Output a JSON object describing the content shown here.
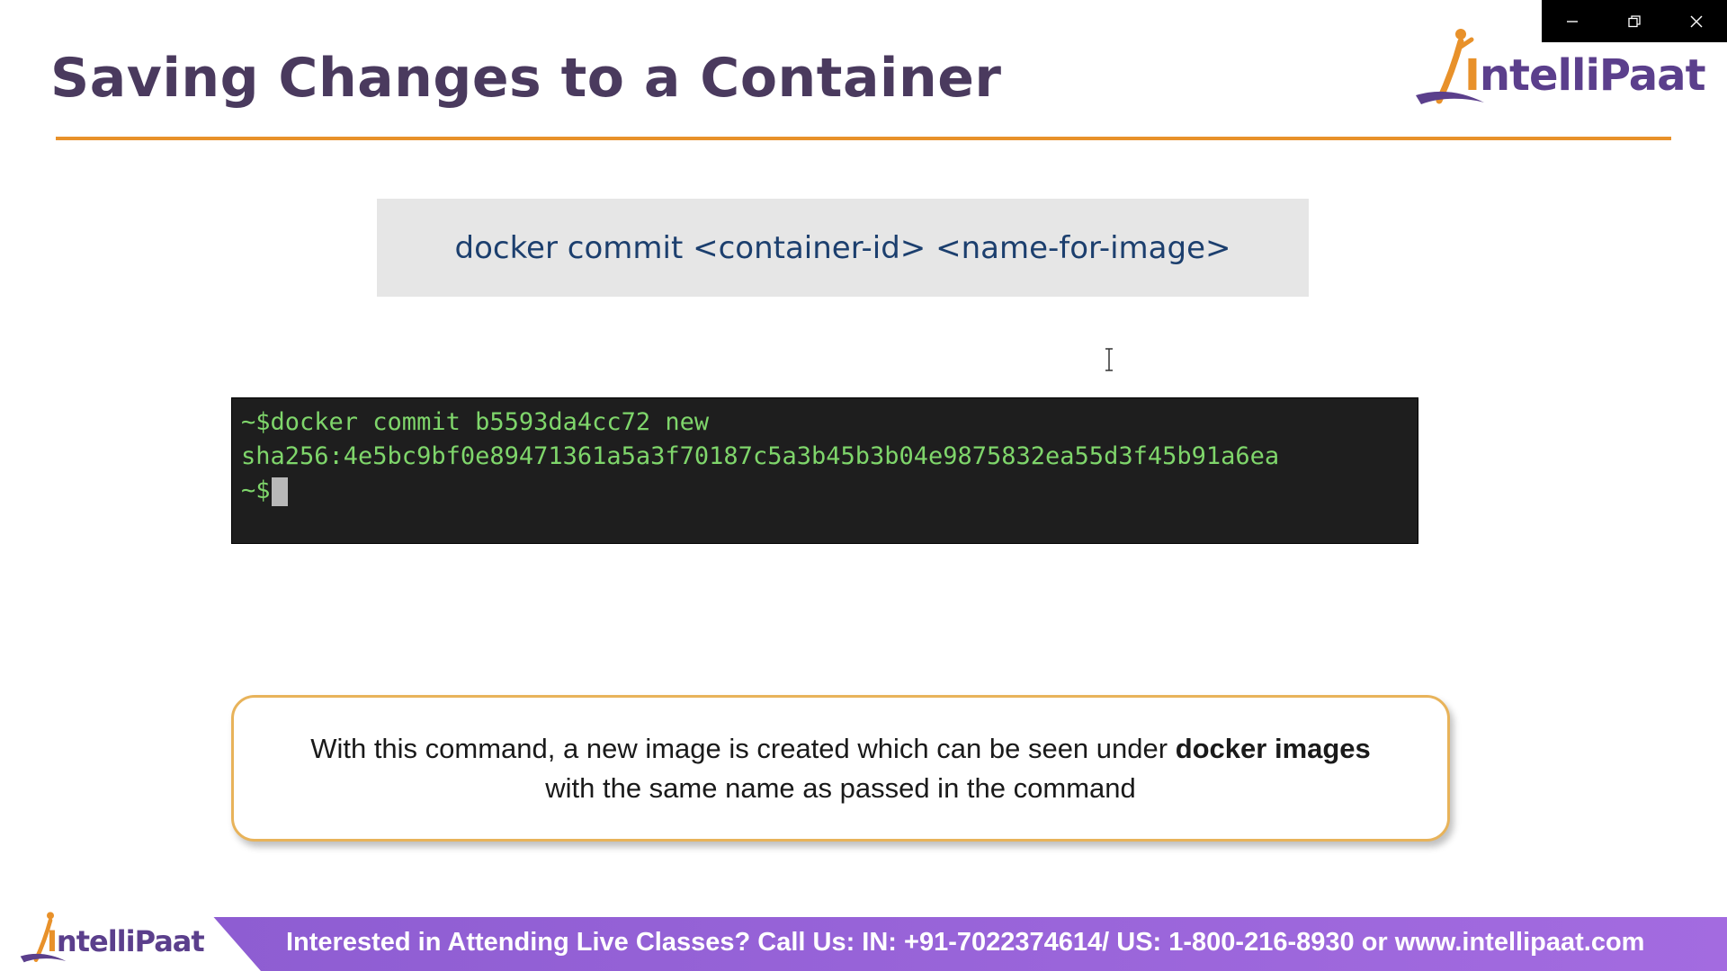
{
  "window": {
    "minimize_icon": "minimize-icon",
    "restore_icon": "restore-icon",
    "close_icon": "close-icon"
  },
  "slide": {
    "title": "Saving Changes to a Container",
    "accent_color": "#e8912a",
    "title_color": "#4a3a5e"
  },
  "logo": {
    "first_letter": "I",
    "rest": "ntelliPaat"
  },
  "command": {
    "text": "docker commit <container-id> <name-for-image>"
  },
  "terminal": {
    "lines": [
      "~$docker commit b5593da4cc72 new",
      "sha256:4e5bc9bf0e89471361a5a3f70187c5a3b45b3b04e9875832ea55d3f45b91a6ea",
      "~$"
    ],
    "text_color": "#7fd66b"
  },
  "note": {
    "line1_prefix": "With this command, a new image is created which can be seen under ",
    "line1_bold": "docker images",
    "line2": "with the same name as passed in the command"
  },
  "banner": {
    "logo_first_letter": "I",
    "logo_rest": "ntelliPaat",
    "text": "Interested in Attending Live Classes? Call Us: IN: +91-7022374614/ US: 1-800-216-8930 or www.intellipaat.com"
  }
}
